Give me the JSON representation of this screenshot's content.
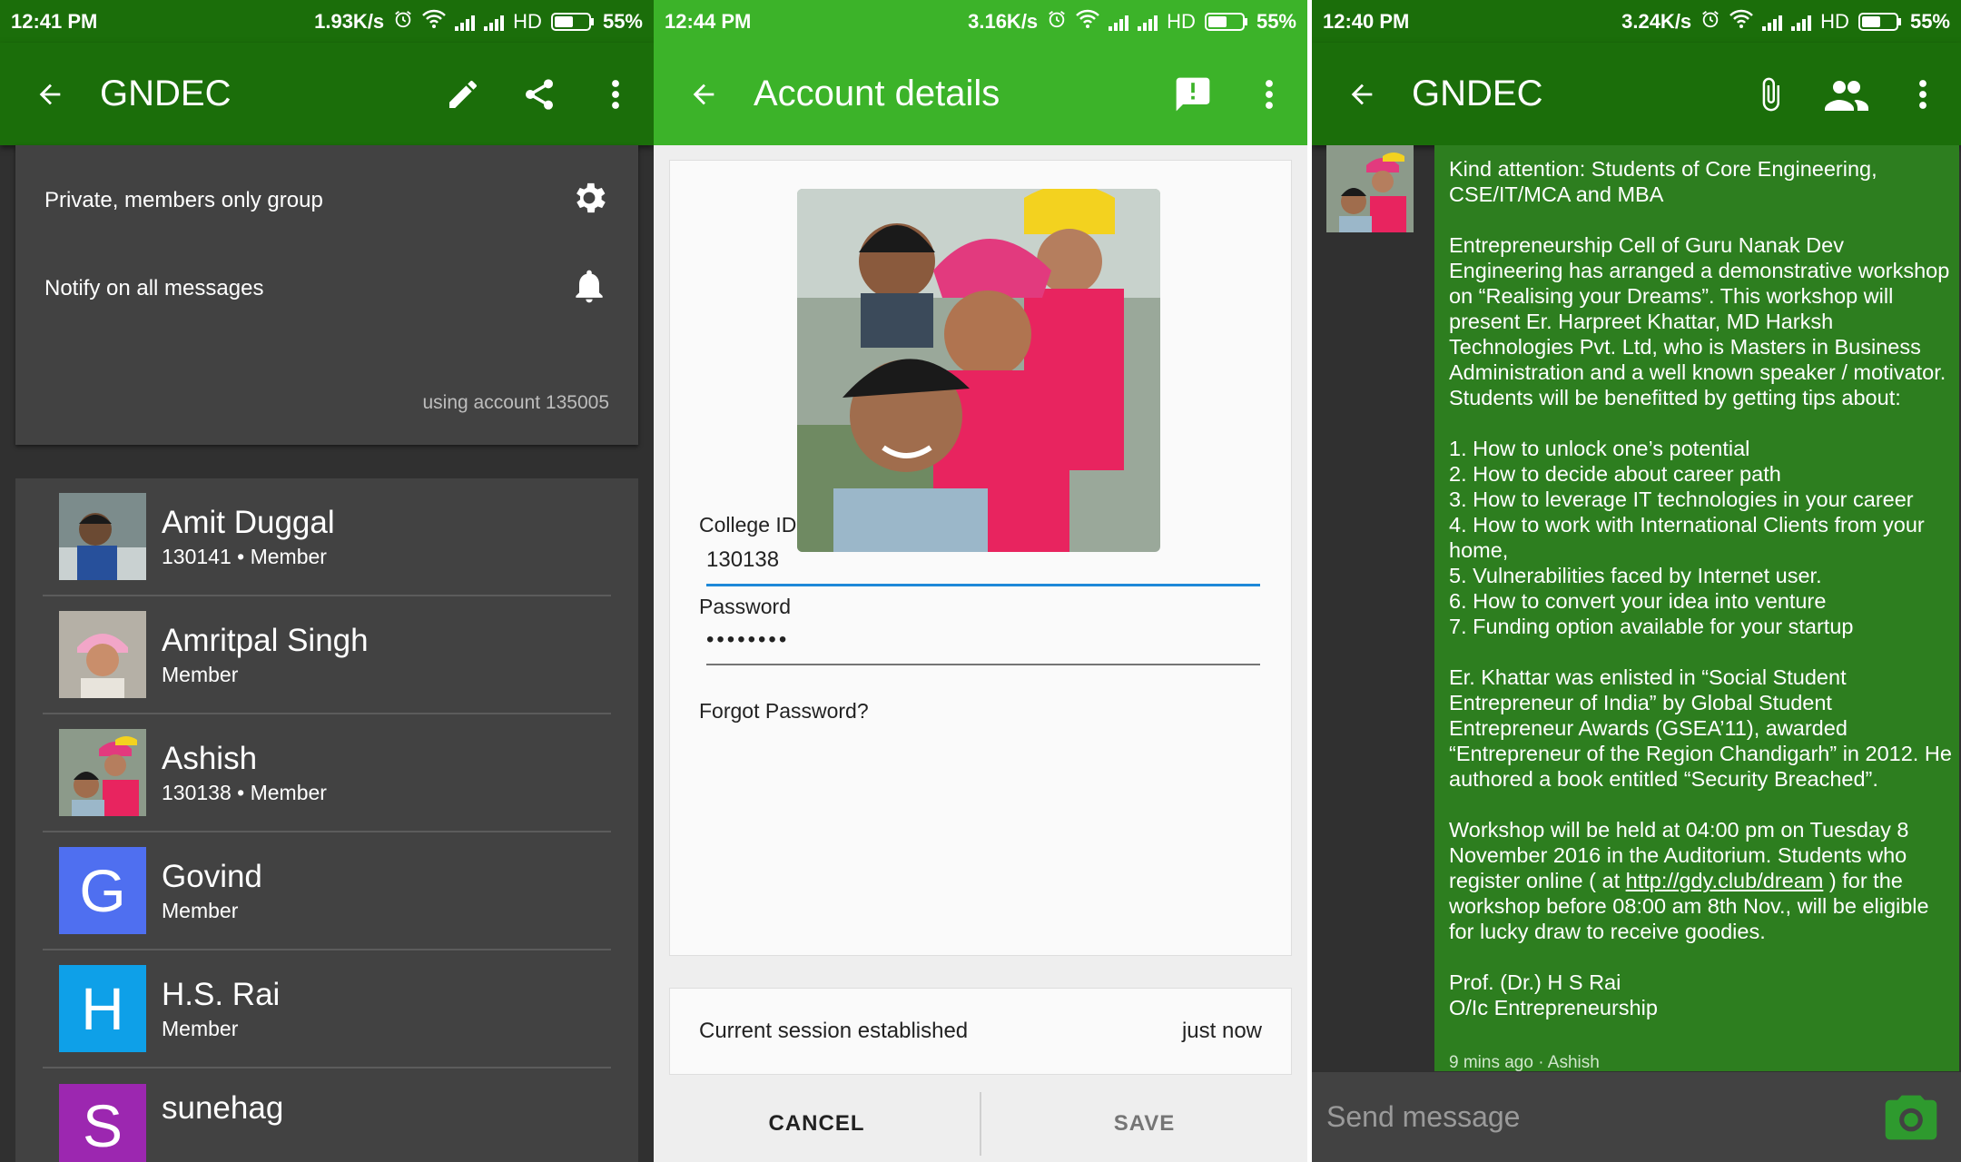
{
  "colors": {
    "dark_green": "#1b6e0a",
    "light_green": "#3cb329",
    "bubble_green": "#2d7e1f",
    "link_blue": "#1d88d8"
  },
  "panel1": {
    "status": {
      "time": "12:41 PM",
      "speed": "1.93K/s",
      "network": "HD",
      "battery": "55%",
      "battery_level": 0.55
    },
    "toolbar": {
      "title": "GNDEC",
      "icons": [
        "back-arrow-icon",
        "pencil-icon",
        "share-icon",
        "more-vert-icon"
      ]
    },
    "settings": {
      "privacy_label": "Private, members only group",
      "notify_label": "Notify on all messages",
      "account_text": "using account 135005"
    },
    "members": [
      {
        "name": "Amit Duggal",
        "sub": "130141 • Member",
        "avatar": "photo"
      },
      {
        "name": "Amritpal Singh",
        "sub": "Member",
        "avatar": "photo"
      },
      {
        "name": "Ashish",
        "sub": "130138 • Member",
        "avatar": "photo"
      },
      {
        "name": "Govind",
        "sub": "Member",
        "avatar": "letter",
        "letter": "G",
        "color": "#4f6ff0"
      },
      {
        "name": "H.S. Rai",
        "sub": "Member",
        "avatar": "letter",
        "letter": "H",
        "color": "#0ea0e8"
      },
      {
        "name": "sunehag",
        "sub": "",
        "avatar": "letter",
        "letter": "S",
        "color": "#9c27b0"
      }
    ]
  },
  "panel2": {
    "status": {
      "time": "12:44 PM",
      "speed": "3.16K/s",
      "network": "HD",
      "battery": "55%",
      "battery_level": 0.55
    },
    "toolbar": {
      "title": "Account details",
      "icons": [
        "back-arrow-icon",
        "feedback-icon",
        "more-vert-icon"
      ]
    },
    "form": {
      "college_id_label": "College ID",
      "college_id_value": "130138",
      "password_label": "Password",
      "password_value": "••••••••",
      "forgot_label": "Forgot Password?"
    },
    "session": {
      "label": "Current session established",
      "time": "just now"
    },
    "actions": {
      "cancel": "CANCEL",
      "save": "SAVE"
    }
  },
  "panel3": {
    "status": {
      "time": "12:40 PM",
      "speed": "3.24K/s",
      "network": "HD",
      "battery": "55%",
      "battery_level": 0.55
    },
    "toolbar": {
      "title": "GNDEC",
      "icons": [
        "back-arrow-icon",
        "attach-icon",
        "group-icon",
        "more-vert-icon"
      ]
    },
    "message": {
      "p1": "Kind attention: Students of Core Engineering, CSE/IT/MCA and MBA",
      "p2": "Entrepreneurship Cell of Guru Nanak Dev Engineering has arranged a demonstrative workshop on “Realising your Dreams”. This workshop will present Er. Harpreet Khattar, MD Harksh Technologies Pvt. Ltd, who is Masters in Business Administration and a well known speaker / motivator. Students will be benefitted by getting tips about:",
      "list": [
        "1. How to unlock one’s potential",
        "2. How to decide about career path",
        "3. How to leverage IT technologies in your career",
        "4. How to work with International Clients from your home,",
        "5. Vulnerabilities faced by Internet user.",
        "6. How to convert your idea into venture",
        "7. Funding option available for your startup"
      ],
      "p3": "Er. Khattar was enlisted in “Social Student Entrepreneur of India” by Global Student Entrepreneur Awards (GSEA’11), awarded “Entrepreneur of the Region Chandigarh” in 2012. He authored a book entitled “Security Breached”.",
      "p4_before": "Workshop will be held at 04:00 pm on Tuesday 8 November 2016 in the Auditorium. Students who register online ( at ",
      "p4_link": "http://gdy.club/dream",
      "p4_after": " ) for the workshop before 08:00 am 8th Nov., will be eligible for lucky draw to receive goodies.",
      "sig1": "Prof. (Dr.) H S Rai",
      "sig2": "O/Ic Entrepreneurship",
      "meta": "9 mins ago · Ashish"
    },
    "composer": {
      "placeholder": "Send message"
    }
  }
}
